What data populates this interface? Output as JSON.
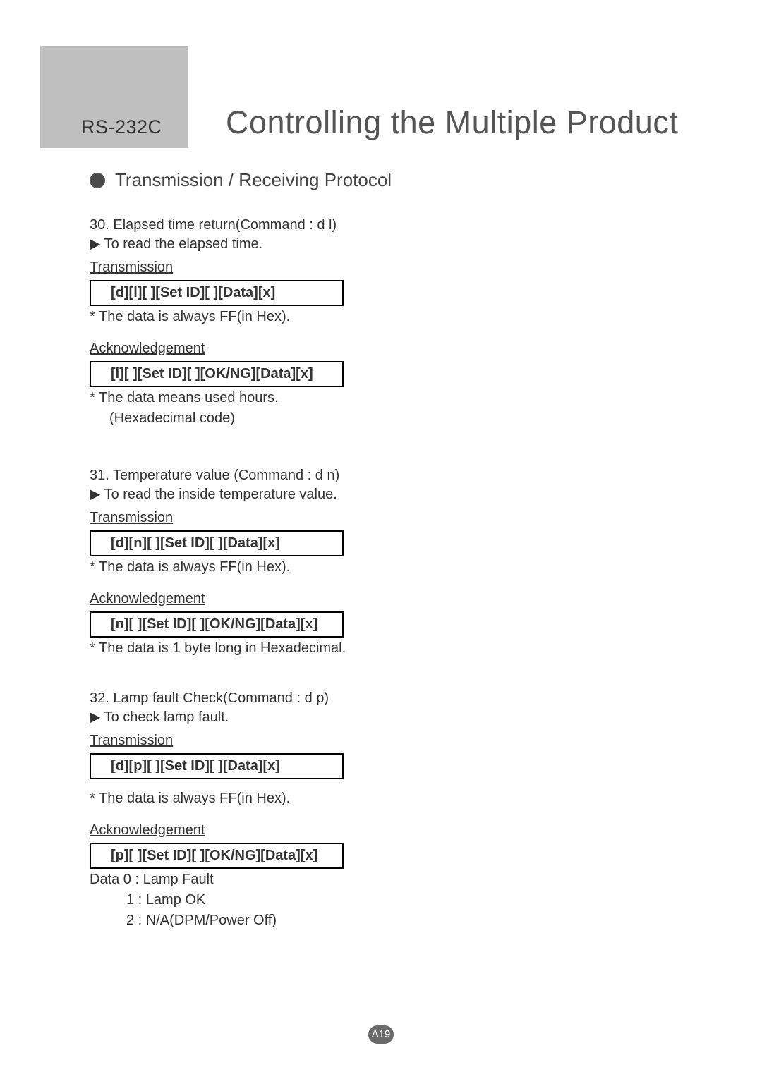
{
  "header": {
    "label": "RS-232C",
    "title": "Controlling the Multiple Product"
  },
  "section": {
    "title": "Transmission / Receiving Protocol"
  },
  "commands": [
    {
      "title": "30. Elapsed time return(Command : d l)",
      "desc": "To read the elapsed time.",
      "tx_label": "Transmission",
      "tx_code": "[d][l][ ][Set ID][ ][Data][x]",
      "tx_note": " * The data is always FF(in Hex).",
      "ack_label": "Acknowledgement",
      "ack_code": "[l][ ][Set ID][ ][OK/NG][Data][x]",
      "ack_note1": " * The data means used hours.",
      "ack_note2": "(Hexadecimal code)"
    },
    {
      "title": "31. Temperature value (Command : d n)",
      "desc": "To read the inside temperature value.",
      "tx_label": "Transmission",
      "tx_code": "[d][n][ ][Set ID][ ][Data][x]",
      "tx_note": "* The data is always FF(in Hex).",
      "ack_label": "Acknowledgement",
      "ack_code": "[n][ ][Set ID][ ][OK/NG][Data][x]",
      "ack_note1": "* The data  is 1 byte long in Hexadecimal."
    },
    {
      "title": "32. Lamp fault Check(Command : d p)",
      "desc": "To check lamp fault.",
      "tx_label": "Transmission",
      "tx_code": "[d][p][ ][Set ID][ ][Data][x]",
      "tx_note": "* The data is always FF(in Hex).",
      "ack_label": "Acknowledgement",
      "ack_code": "[p][ ][Set ID][ ][OK/NG][Data][x]",
      "ack_note1": "Data 0 : Lamp Fault",
      "ack_note2": "1 : Lamp OK",
      "ack_note3": "2 : N/A(DPM/Power Off)"
    }
  ],
  "page_number": "A19"
}
